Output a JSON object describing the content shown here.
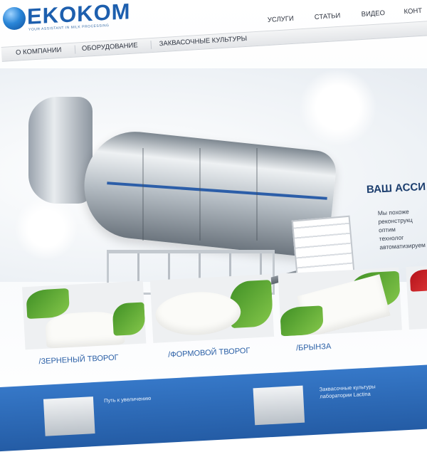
{
  "brand": {
    "name": "EKOKOM",
    "tagline": "YOUR ASSISTANT IN MILK PROCESSING"
  },
  "nav": {
    "secondary": [
      "УСЛУГИ",
      "СТАТЬИ",
      "ВИДЕО",
      "КОНТ"
    ],
    "main": [
      "О КОМПАНИИ",
      "ОБОРУДОВАНИЕ",
      "ЗАКВАСОЧНЫЕ КУЛЬТУРЫ"
    ]
  },
  "hero": {
    "headline": "ВАШ АССИ",
    "lines": [
      "Мы похоже",
      "реконструкц",
      "оптим",
      "технолог",
      "автоматизируем"
    ]
  },
  "products": [
    {
      "label": "/ЗЕРНЕНЫЙ ТВОРОГ"
    },
    {
      "label": "/ФОРМОВОЙ ТВОРОГ"
    },
    {
      "label": "/БРЫНЗА"
    }
  ],
  "bottom": {
    "item1": [
      "Путь к увеличению"
    ],
    "item2": [
      "Заквасочные культуры",
      "лаборатории Lactina"
    ]
  },
  "colors": {
    "brand_blue": "#1d5fae",
    "link_blue": "#2a5fa6",
    "band_blue": "#3678c8"
  }
}
